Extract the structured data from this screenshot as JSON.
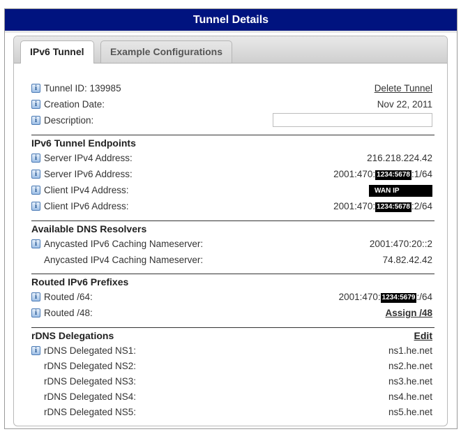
{
  "window": {
    "title": "Tunnel Details"
  },
  "tabs": [
    {
      "label": "IPv6 Tunnel",
      "active": true
    },
    {
      "label": "Example Configurations",
      "active": false
    }
  ],
  "tunnel": {
    "id_label": "Tunnel ID: 139985",
    "delete_link": "Delete Tunnel",
    "creation_label": "Creation Date:",
    "creation_value": "Nov 22, 2011",
    "description_label": "Description:",
    "description_value": ""
  },
  "endpoints": {
    "heading": "IPv6 Tunnel Endpoints",
    "server_ipv4_label": "Server IPv4 Address:",
    "server_ipv4_value": "216.218.224.42",
    "server_ipv6_label": "Server IPv6 Address:",
    "server_ipv6_prefix": "2001:470:",
    "server_ipv6_redacted": "1234:5678",
    "server_ipv6_suffix": ":1/64",
    "client_ipv4_label": "Client IPv4 Address:",
    "client_ipv4_value": "WAN IP",
    "client_ipv6_label": "Client IPv6 Address:",
    "client_ipv6_prefix": "2001:470:",
    "client_ipv6_redacted": "1234:5678",
    "client_ipv6_suffix": ":2/64"
  },
  "dns": {
    "heading": "Available DNS Resolvers",
    "ipv6_label": "Anycasted IPv6 Caching Nameserver:",
    "ipv6_value": "2001:470:20::2",
    "ipv4_label": "Anycasted IPv4 Caching Nameserver:",
    "ipv4_value": "74.82.42.42"
  },
  "prefixes": {
    "heading": "Routed IPv6 Prefixes",
    "r64_label": "Routed /64:",
    "r64_prefix": "2001:470:",
    "r64_redacted": "1234:5679",
    "r64_suffix": ":/64",
    "r48_label": "Routed /48:",
    "r48_link": "Assign /48"
  },
  "rdns": {
    "heading": "rDNS Delegations",
    "edit_link": "Edit",
    "items": [
      {
        "label": "rDNS Delegated NS1:",
        "value": "ns1.he.net"
      },
      {
        "label": "rDNS Delegated NS2:",
        "value": "ns2.he.net"
      },
      {
        "label": "rDNS Delegated NS3:",
        "value": "ns3.he.net"
      },
      {
        "label": "rDNS Delegated NS4:",
        "value": "ns4.he.net"
      },
      {
        "label": "rDNS Delegated NS5:",
        "value": "ns5.he.net"
      }
    ]
  },
  "icons": {
    "info": "info-icon",
    "info_glyph": "i"
  },
  "colors": {
    "titlebar": "#00137f",
    "info_icon": "#4a7ab5"
  }
}
